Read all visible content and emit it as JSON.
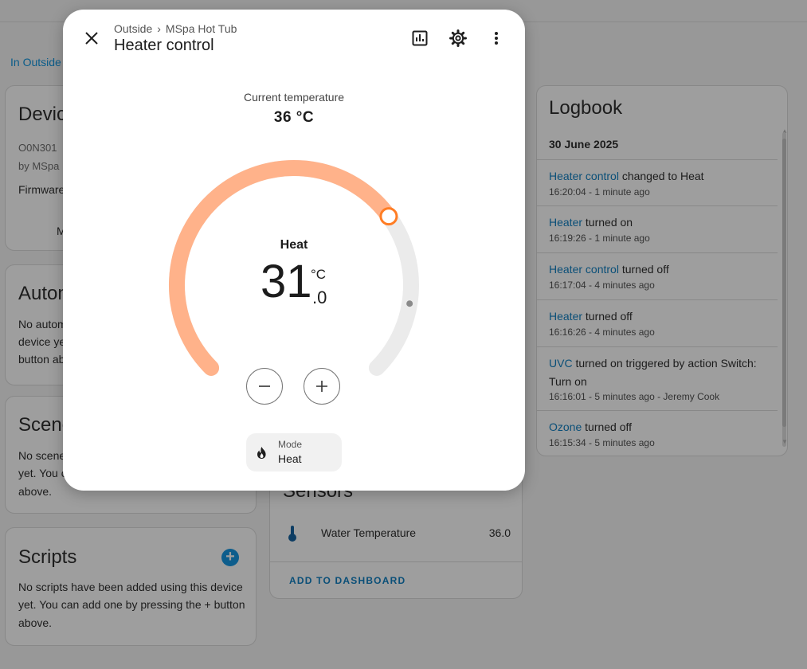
{
  "background": {
    "breadcrumb_link": "In Outside"
  },
  "device_card": {
    "title": "Devic",
    "model": "O0N301",
    "maker": "by MSpa",
    "firmware": "Firmware",
    "more": "M"
  },
  "automations_card": {
    "title": "Autom",
    "text_lines": [
      "No autom",
      "device ye",
      "button ab"
    ]
  },
  "scenes_card": {
    "title": "Scene",
    "text_lines": [
      "No scene",
      "yet. You c",
      "above."
    ]
  },
  "scripts_card": {
    "title": "Scripts",
    "add_icon": "plus-circle-icon",
    "text_lines": [
      "No scripts have been added using this device",
      "yet. You can add one by pressing the + button",
      "above."
    ]
  },
  "sensors_card": {
    "title": "Sensors",
    "items": [
      {
        "icon": "thermometer-icon",
        "name": "Water Temperature",
        "value": "36.0"
      }
    ],
    "action": "ADD TO DASHBOARD"
  },
  "logbook": {
    "title": "Logbook",
    "date": "30 June 2025",
    "entries": [
      {
        "entity": "Heater control",
        "message": " changed to Heat",
        "time": "16:20:04 - 1 minute ago"
      },
      {
        "entity": "Heater",
        "message": " turned on",
        "time": "16:19:26 - 1 minute ago"
      },
      {
        "entity": "Heater control",
        "message": " turned off",
        "time": "16:17:04 - 4 minutes ago"
      },
      {
        "entity": "Heater",
        "message": " turned off",
        "time": "16:16:26 - 4 minutes ago"
      },
      {
        "entity": "UVC",
        "message": " turned on triggered by action Switch: Turn on",
        "time": "16:16:01 - 5 minutes ago - Jeremy Cook"
      },
      {
        "entity": "Ozone",
        "message": " turned off",
        "time": "16:15:34 - 5 minutes ago"
      }
    ]
  },
  "dialog": {
    "breadcrumb": [
      "Outside",
      "MSpa Hot Tub"
    ],
    "title": "Heater control",
    "icons": [
      "close-icon",
      "history-chart-icon",
      "settings-gear-icon",
      "more-vert-icon"
    ],
    "current_label": "Current temperature",
    "current_value": "36 °C",
    "hvac_action": "Heat",
    "target_integer": "31",
    "target_unit": "°C",
    "target_decimal": ".0",
    "minus_icon": "minus-icon",
    "plus_icon": "plus-icon",
    "mode_chip": {
      "label": "Mode",
      "value": "Heat",
      "icon": "fire-icon"
    },
    "colors": {
      "heat_accent": "#ff7d24",
      "heat_arc": "#ffb28a",
      "track": "#ebebeb"
    },
    "dial": {
      "min": 10,
      "max": 40,
      "target": 31,
      "current": 36,
      "target_fraction": 0.7,
      "current_fraction": 0.867
    }
  }
}
